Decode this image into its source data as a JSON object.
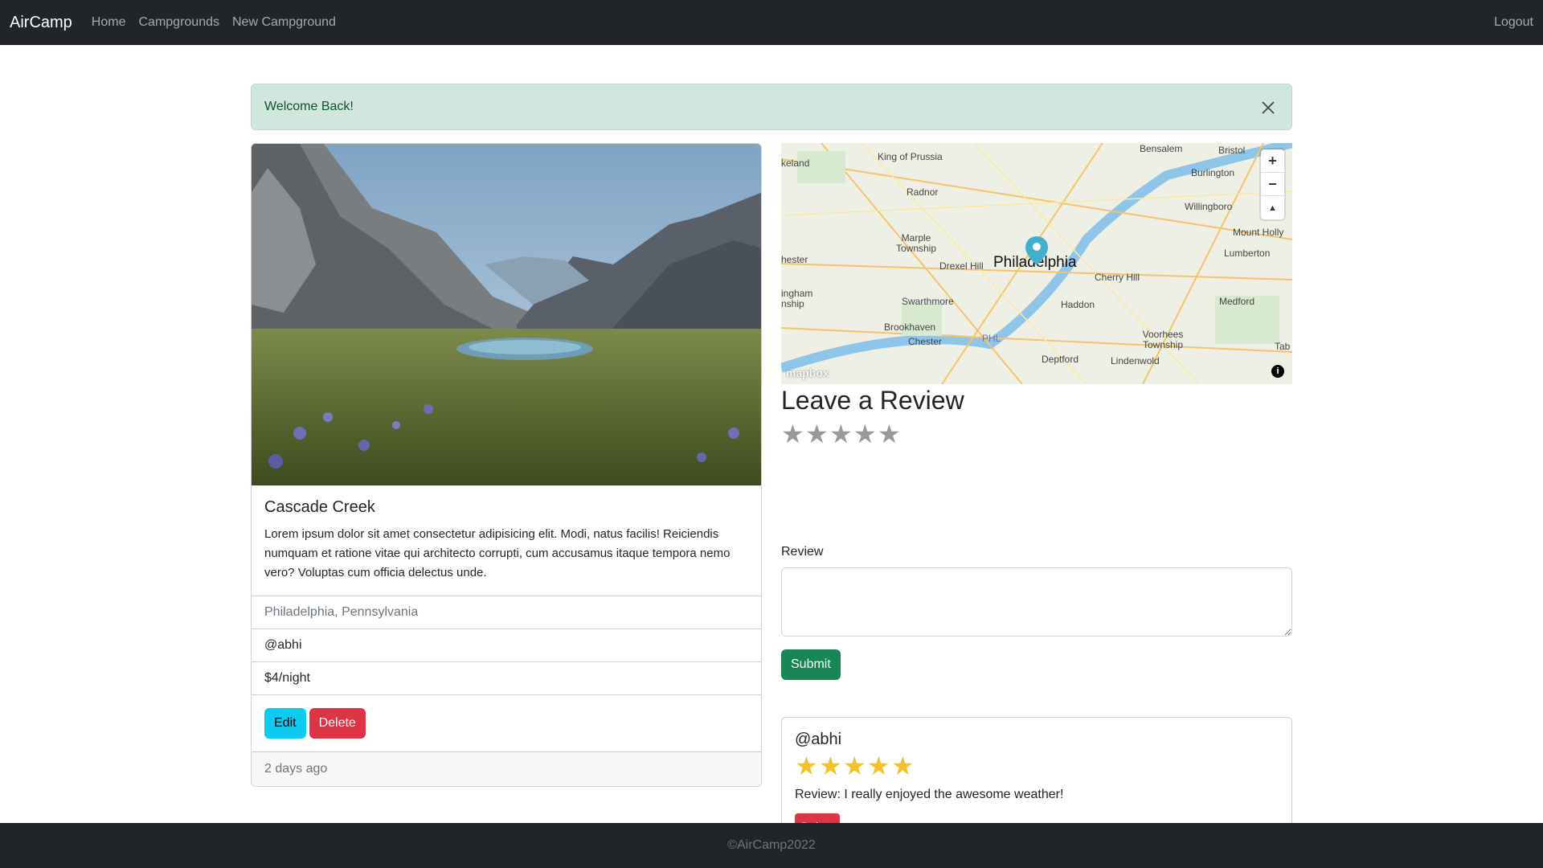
{
  "navbar": {
    "brand": "AirCamp",
    "links": [
      "Home",
      "Campgrounds",
      "New Campground"
    ],
    "logout": "Logout"
  },
  "alert": {
    "message": "Welcome Back!",
    "close_icon": "close-icon"
  },
  "campground": {
    "title": "Cascade Creek",
    "description": "Lorem ipsum dolor sit amet consectetur adipisicing elit. Modi, natus facilis! Reiciendis numquam et ratione vitae qui architecto corrupti, cum accusamus itaque tempora nemo vero? Voluptas cum officia delectus unde.",
    "location": "Philadelphia, Pennsylvania",
    "author": "@abhi",
    "price": "$4/night",
    "edit_label": "Edit",
    "delete_label": "Delete",
    "posted": "2 days ago"
  },
  "map": {
    "city": "Philadelphia",
    "labels": [
      "Bensalem",
      "Bristol",
      "King of Prussia",
      "Burlington",
      "Radnor",
      "Willingboro",
      "Marple Township",
      "Mount Holly",
      "Drexel Hill",
      "Lumberton",
      "Cherry Hill",
      "Swarthmore",
      "Haddon",
      "Medford",
      "Brookhaven",
      "Chester",
      "Voorhees Township",
      "Deptford",
      "Lindenwold",
      "keland",
      "hester",
      "ingham",
      "nship",
      "Tab",
      "PHL"
    ],
    "zoom_in": "+",
    "zoom_out": "−",
    "compass": "▲",
    "attribution": "mapbox",
    "info": "i"
  },
  "review_form": {
    "heading": "Leave a Review",
    "rating_stars": 5,
    "review_label": "Review",
    "review_value": "",
    "submit_label": "Submit"
  },
  "reviews": [
    {
      "user": "@abhi",
      "rating": 5,
      "text": "Review: I really enjoyed the awesome weather!",
      "delete_label": "Delete"
    }
  ],
  "footer": {
    "copyright": "©AirCamp2022"
  },
  "colors": {
    "navbar": "#212529",
    "alert_bg": "#d1e7dd",
    "info_button": "#0dcaf0",
    "danger_button": "#dc3545",
    "success_button": "#198754",
    "star_filled": "#f2c12e",
    "star_empty": "#999999"
  }
}
